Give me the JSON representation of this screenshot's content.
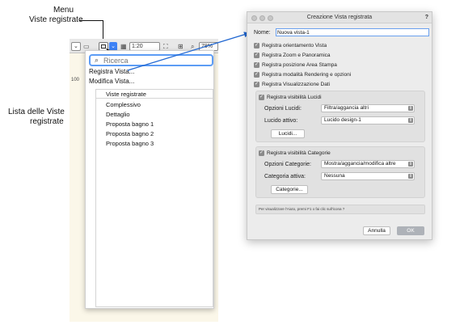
{
  "annotations": {
    "menu_line1": "Menu",
    "menu_line2": "Viste registrate",
    "list_line1": "Lista delle Viste",
    "list_line2": "registrate"
  },
  "toolbar": {
    "scale": "1:20",
    "zoom": "78%",
    "ruler": "100"
  },
  "dropdown": {
    "search_placeholder": "Ricerca",
    "save_view": "Registra Vista...",
    "edit_view": "Modifica Vista...",
    "list_header": "Viste registrate",
    "views": [
      "Complessivo",
      "Dettaglio",
      "Proposta bagno 1",
      "Proposta bagno 2",
      "Proposta bagno 3"
    ]
  },
  "dialog": {
    "title": "Creazione Vista registrata",
    "help": "?",
    "name_label": "Nome:",
    "name_value": "Nuova vista-1",
    "options": [
      "Registra orientamento Vista",
      "Registra Zoom e Panoramica",
      "Registra posizione Area Stampa",
      "Registra modalità Rendering e opzioni",
      "Registra Visualizzazione Dati"
    ],
    "layers": {
      "checkbox": "Registra visibilità Lucidi",
      "options_label": "Opzioni Lucidi:",
      "options_value": "Filtra/aggancia altri",
      "active_label": "Lucido attivo:",
      "active_value": "Lucido design-1",
      "button": "Lucidi..."
    },
    "categories": {
      "checkbox": "Registra visibilità Categorie",
      "options_label": "Opzioni Categorie:",
      "options_value": "Mostra/aggancia/modifica altre",
      "active_label": "Categoria attiva:",
      "active_value": "Nessuna",
      "button": "Categorie..."
    },
    "status": "Per visualizzare l'Aiuto, premi F1 o fai clic sull'icona ?",
    "cancel": "Annulla",
    "ok": "OK"
  }
}
